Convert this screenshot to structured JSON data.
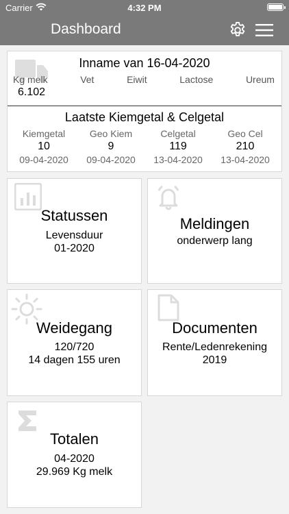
{
  "status_bar": {
    "carrier": "Carrier",
    "time": "4:32 PM"
  },
  "nav": {
    "title": "Dashboard",
    "settings_icon": "gear-icon",
    "menu_icon": "hamburger-menu-icon"
  },
  "inname": {
    "title": "Inname van 16-04-2020",
    "icon": "truck-icon",
    "labels": [
      "Kg melk",
      "Vet",
      "Eiwit",
      "Lactose",
      "Ureum"
    ],
    "kg_melk_value": "6.102",
    "subtitle": "Laatste Kiemgetal & Celgetal",
    "columns": [
      {
        "label": "Kiemgetal",
        "value": "10",
        "date": "09-04-2020"
      },
      {
        "label": "Geo Kiem",
        "value": "9",
        "date": "09-04-2020"
      },
      {
        "label": "Celgetal",
        "value": "119",
        "date": "13-04-2020"
      },
      {
        "label": "Geo Cel",
        "value": "210",
        "date": "13-04-2020"
      }
    ]
  },
  "tiles": {
    "statussen": {
      "title": "Statussen",
      "line1": "Levensduur",
      "line2": "01-2020",
      "icon": "bar-chart-icon"
    },
    "meldingen": {
      "title": "Meldingen",
      "line1": "onderwerp lang",
      "icon": "bell-icon"
    },
    "weidegang": {
      "title": "Weidegang",
      "line1": "120/720",
      "line2": "14 dagen 155 uren",
      "icon": "sun-icon"
    },
    "documenten": {
      "title": "Documenten",
      "line1": "Rente/Ledenrekening",
      "line2": "2019",
      "icon": "document-icon"
    },
    "totalen": {
      "title": "Totalen",
      "line1": "04-2020",
      "line2": "29.969 Kg melk",
      "icon": "sigma-icon"
    }
  },
  "colors": {
    "header": "#7a7a7a",
    "background": "#f2f2f2",
    "icon_watermark": "#dcdcdc"
  }
}
